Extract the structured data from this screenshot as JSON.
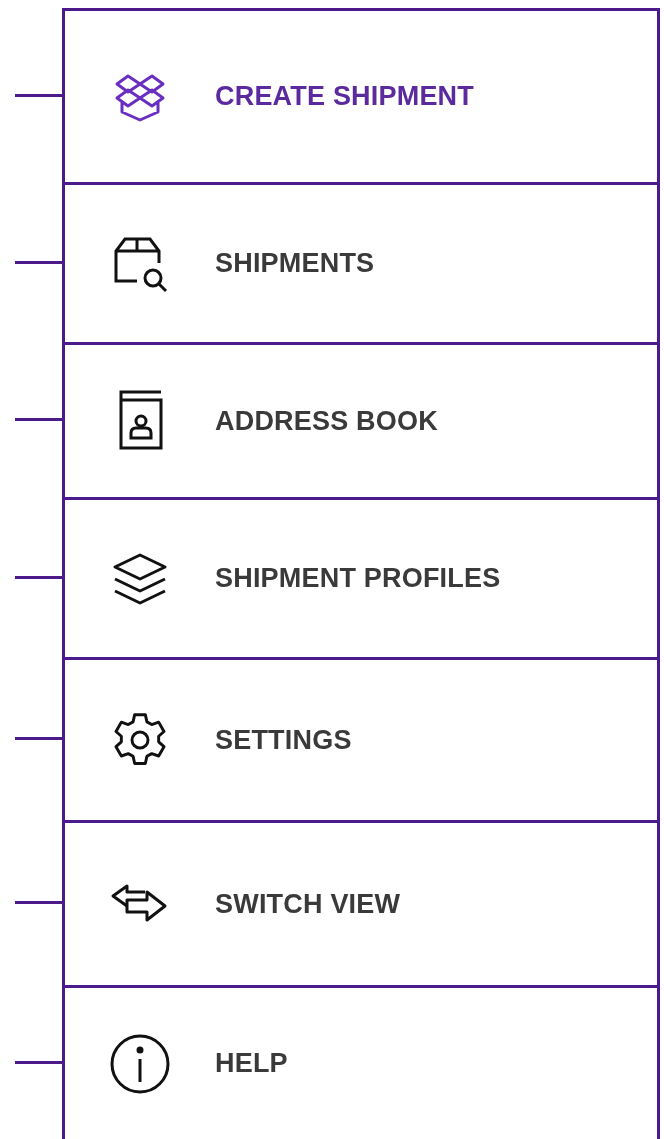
{
  "menu": {
    "items": [
      {
        "label": "CREATE SHIPMENT",
        "kind": "boxes",
        "selected": true
      },
      {
        "label": "SHIPMENTS",
        "kind": "package-search",
        "selected": false
      },
      {
        "label": "ADDRESS BOOK",
        "kind": "contact-book",
        "selected": false
      },
      {
        "label": "SHIPMENT PROFILES",
        "kind": "layers",
        "selected": false
      },
      {
        "label": "SETTINGS",
        "kind": "gear",
        "selected": false
      },
      {
        "label": "SWITCH VIEW",
        "kind": "swap",
        "selected": false
      },
      {
        "label": "HELP",
        "kind": "info",
        "selected": false
      }
    ]
  }
}
